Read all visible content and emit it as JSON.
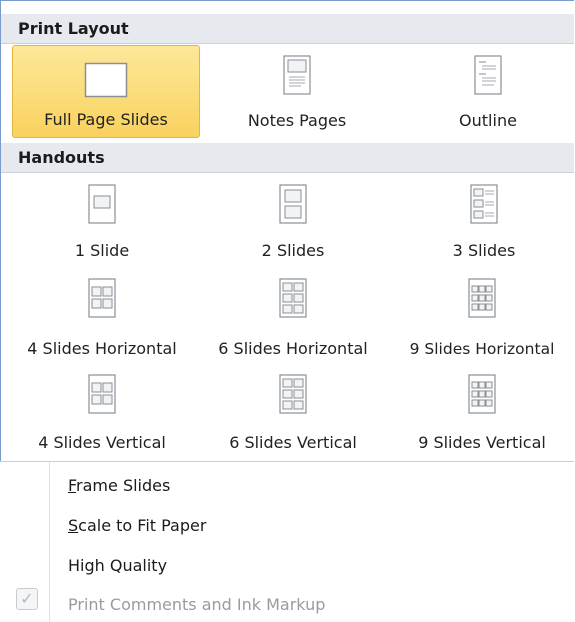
{
  "print_layout": {
    "header": "Print Layout",
    "items": [
      {
        "label": "Full Page Slides",
        "selected": true,
        "icon": "full-page-slide-icon"
      },
      {
        "label": "Notes Pages",
        "selected": false,
        "icon": "notes-pages-icon"
      },
      {
        "label": "Outline",
        "selected": false,
        "icon": "outline-icon"
      }
    ]
  },
  "handouts": {
    "header": "Handouts",
    "items": [
      {
        "label": "1 Slide",
        "icon": "handout-1-slide-icon"
      },
      {
        "label": "2 Slides",
        "icon": "handout-2-slides-icon"
      },
      {
        "label": "3 Slides",
        "icon": "handout-3-slides-icon"
      },
      {
        "label": "4 Slides Horizontal",
        "icon": "handout-4-horizontal-icon"
      },
      {
        "label": "6 Slides Horizontal",
        "icon": "handout-6-horizontal-icon"
      },
      {
        "label": "9 Slides Horizontal",
        "icon": "handout-9-horizontal-icon"
      },
      {
        "label": "4 Slides Vertical",
        "icon": "handout-4-vertical-icon"
      },
      {
        "label": "6 Slides Vertical",
        "icon": "handout-6-vertical-icon"
      },
      {
        "label": "9 Slides Vertical",
        "icon": "handout-9-vertical-icon"
      }
    ]
  },
  "options": [
    {
      "label_mnemonic": "F",
      "label_rest": "rame Slides",
      "enabled": true
    },
    {
      "label_mnemonic": "S",
      "label_rest": "cale to Fit Paper",
      "enabled": true
    },
    {
      "label_mnemonic": "",
      "label_rest": "High Quality",
      "enabled": true
    },
    {
      "label_mnemonic": "",
      "label_rest": "Print Comments and Ink Markup",
      "enabled": false,
      "checked": true
    }
  ],
  "colors": {
    "selected_fill": "#f9d25e",
    "selected_border": "#e2b73e",
    "header_bg": "#e6e9ee",
    "disabled_text": "#9b9b9b",
    "frame_border": "#7a9bcf"
  }
}
